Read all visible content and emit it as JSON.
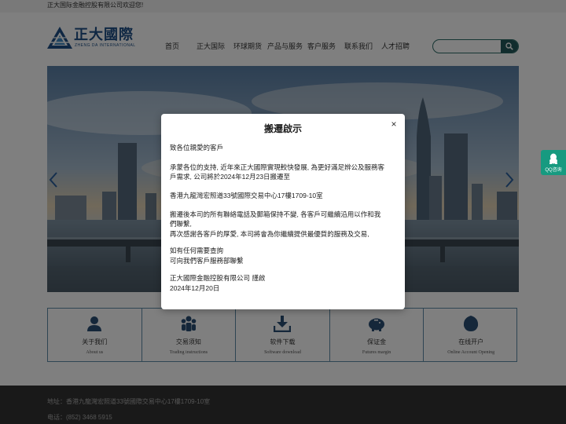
{
  "topbar": {
    "welcome": "正大国际金融控股有限公司欢迎您!"
  },
  "logo": {
    "cn": "正大國際",
    "en": "ZHENG DA INTERNATIONAL",
    "icon": "zhengda-logo-icon"
  },
  "nav": [
    "首页",
    "正大国际",
    "环球期货",
    "产品与服务",
    "客户服务",
    "联系我们",
    "人才招聘"
  ],
  "search": {
    "placeholder": "",
    "icon": "search-icon"
  },
  "banner": {
    "image": "city-skyline-photo",
    "prev_icon": "chevron-left-icon",
    "next_icon": "chevron-right-icon"
  },
  "features": [
    {
      "title": "关于我们",
      "subtitle": "About us",
      "icon": "user-icon"
    },
    {
      "title": "交易须知",
      "subtitle": "Trading instructions",
      "icon": "group-icon"
    },
    {
      "title": "软件下载",
      "subtitle": "Software download",
      "icon": "download-icon"
    },
    {
      "title": "保证金",
      "subtitle": "Futures margin",
      "icon": "piggy-bank-icon"
    },
    {
      "title": "在线开户",
      "subtitle": "Online Account Opening",
      "icon": "account-icon"
    }
  ],
  "footer": {
    "address": "地址：香港九龍灣宏照道33號國際交易中心17樓1709-10室",
    "phone": "电话：(852) 3468 5915"
  },
  "qq": {
    "label": "QQ咨询",
    "icon": "qq-penguin-icon"
  },
  "modal": {
    "title": "搬遷啟示",
    "close": "×",
    "lines": [
      "致各位親愛的客戶",
      "承蒙各位的支持, 近年來正大國際實現較快發展, 為更好滿足辨公及服務客",
      "戶需求, 公司將於2024年12月23日搬遷至",
      "香港九龍灣宏照道33號國際交易中心17樓1709-10室",
      "搬遷後本司的所有聯絡電話及郵箱保持不變, 各客戶可繼續沿用以作和我",
      "們聯繫,",
      "再次感謝各客戶的厚愛, 本司將會為你繼續提供最優質的服務及交易,",
      "如有任何需要查詢",
      "可向我們客戶服務部聯繫",
      "正大國際金融控股有限公司 謹啟",
      "2024年12月20日"
    ]
  },
  "colors": {
    "brand": "#1f4f86",
    "accent": "#22595a",
    "qq": "#179a80",
    "footer": "#333333"
  }
}
